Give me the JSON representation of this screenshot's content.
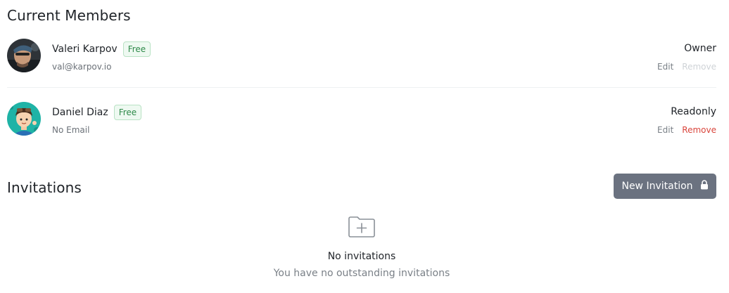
{
  "members_section": {
    "title": "Current Members",
    "members": [
      {
        "name": "Valeri Karpov",
        "plan_badge": "Free",
        "email": "val@karpov.io",
        "role": "Owner",
        "edit_label": "Edit",
        "remove_label": "Remove",
        "remove_enabled": false
      },
      {
        "name": "Daniel Diaz",
        "plan_badge": "Free",
        "email": "No Email",
        "role": "Readonly",
        "edit_label": "Edit",
        "remove_label": "Remove",
        "remove_enabled": true
      }
    ]
  },
  "invitations_section": {
    "title": "Invitations",
    "new_invitation_label": "New Invitation",
    "new_invitation_icon": "lock-icon",
    "empty_icon": "folder-plus-icon",
    "empty_title": "No invitations",
    "empty_subtitle": "You have no outstanding invitations"
  },
  "colors": {
    "badge_text": "#2f8a4a",
    "badge_bg": "#eef9f1",
    "remove_active": "#d9453c",
    "remove_disabled": "#cfd3d7",
    "button_bg": "#6b7280"
  }
}
